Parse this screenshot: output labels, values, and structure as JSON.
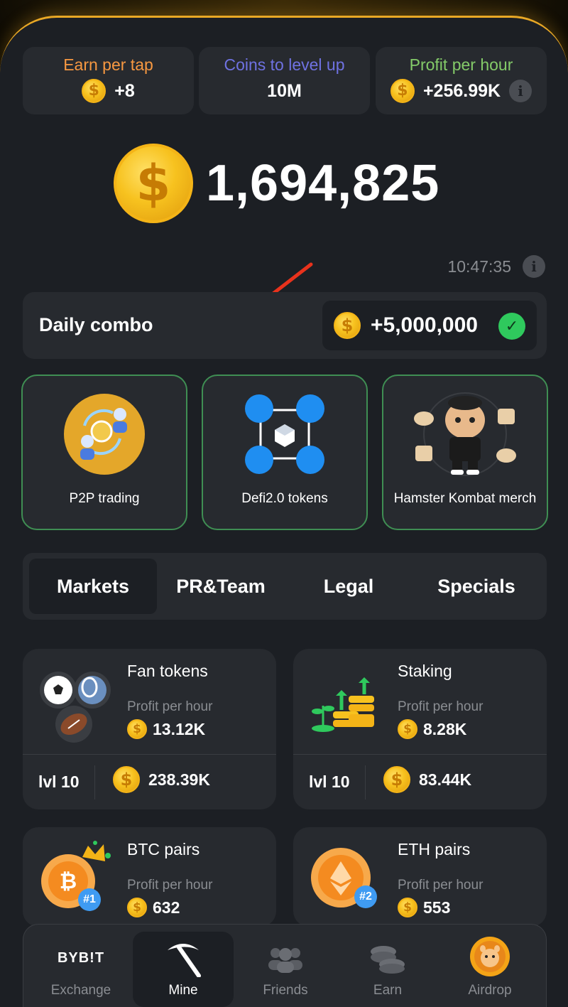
{
  "stats": [
    {
      "label": "Earn per tap",
      "value": "+8",
      "color": "#f79841"
    },
    {
      "label": "Coins to level up",
      "value": "10M",
      "color": "#6f72e2"
    },
    {
      "label": "Profit per hour",
      "value": "+256.99K",
      "color": "#84cb69"
    }
  ],
  "balance": "1,694,825",
  "timer": "10:47:35",
  "combo": {
    "title": "Daily combo",
    "reward": "+5,000,000"
  },
  "cards": [
    {
      "label": "P2P trading"
    },
    {
      "label": "Defi2.0 tokens"
    },
    {
      "label": "Hamster Kombat merch"
    }
  ],
  "tabs": [
    "Markets",
    "PR&Team",
    "Legal",
    "Specials"
  ],
  "markets": [
    {
      "name": "Fan tokens",
      "pph_label": "Profit per hour",
      "pph": "13.12K",
      "level": "lvl 10",
      "cost": "238.39K"
    },
    {
      "name": "Staking",
      "pph_label": "Profit per hour",
      "pph": "8.28K",
      "level": "lvl 10",
      "cost": "83.44K"
    },
    {
      "name": "BTC pairs",
      "pph_label": "Profit per hour",
      "pph": "632"
    },
    {
      "name": "ETH pairs",
      "pph_label": "Profit per hour",
      "pph": "553"
    }
  ],
  "badges": {
    "btc": "#1",
    "eth": "#2"
  },
  "nav": {
    "brand": "BYB!T",
    "items": [
      "Exchange",
      "Mine",
      "Friends",
      "Earn",
      "Airdrop"
    ]
  },
  "coin_symbol": "$",
  "info_symbol": "i",
  "check_symbol": "✓"
}
